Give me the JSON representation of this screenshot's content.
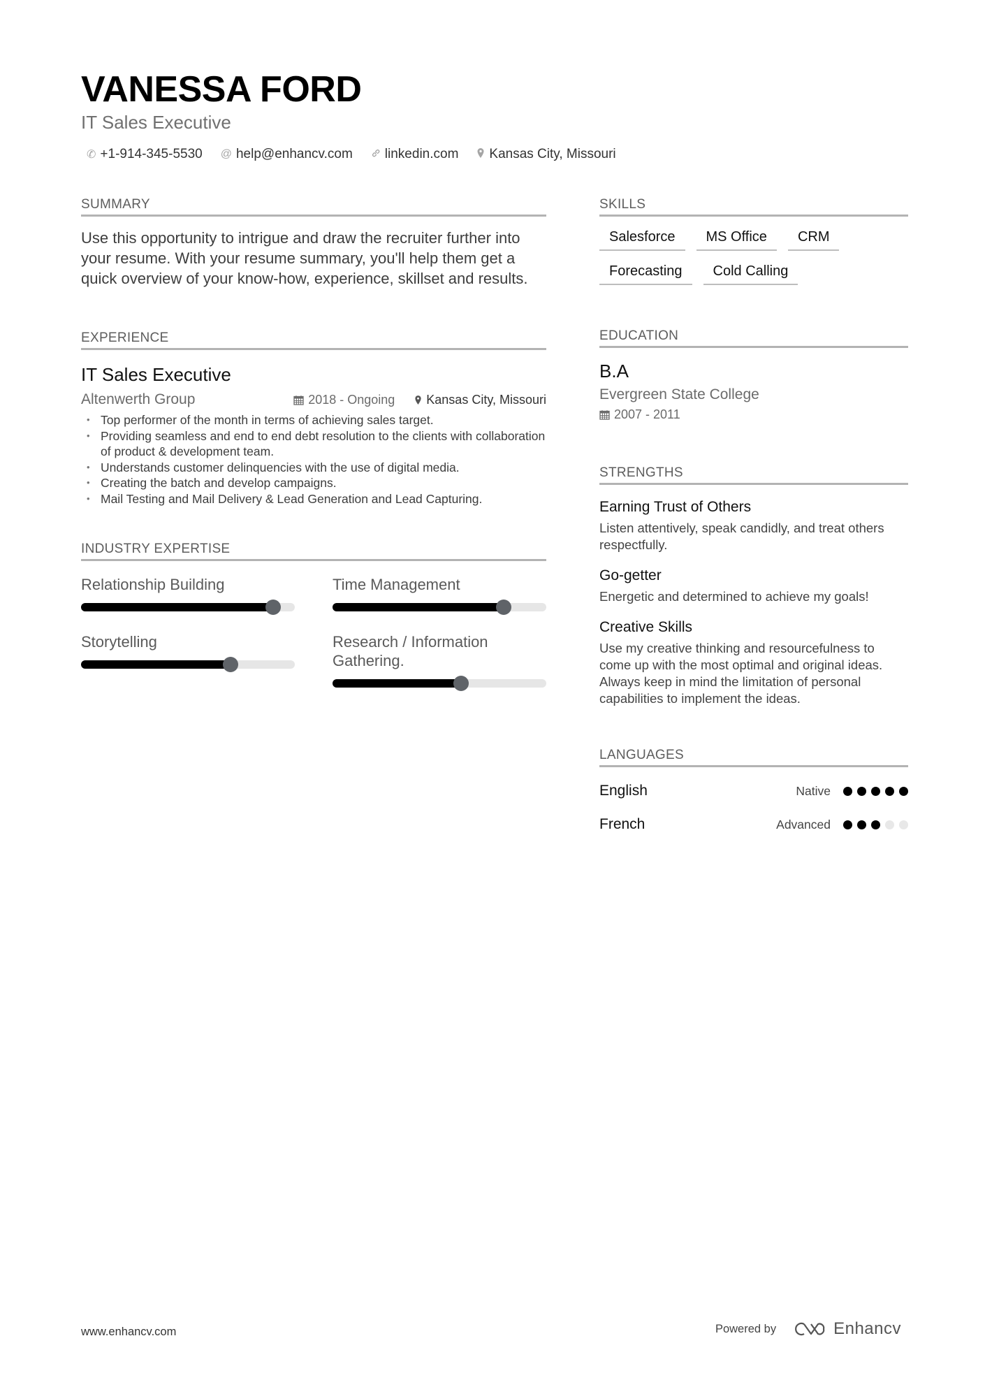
{
  "header": {
    "name": "VANESSA FORD",
    "title": "IT Sales Executive",
    "contacts": [
      {
        "icon": "phone-icon",
        "glyph": "✆",
        "text": "+1-914-345-5530"
      },
      {
        "icon": "at-icon",
        "glyph": "@",
        "text": "help@enhancv.com"
      },
      {
        "icon": "link-icon",
        "glyph": "🔗︎",
        "text": "linkedin.com"
      },
      {
        "icon": "location-pin-icon",
        "glyph": "⚲",
        "text": "Kansas City, Missouri"
      }
    ]
  },
  "summary": {
    "heading": "SUMMARY",
    "text": "Use this opportunity to intrigue and draw the recruiter further into your resume. With your resume summary, you'll help them get a quick overview of your know-how, experience, skillset and results."
  },
  "experience": {
    "heading": "EXPERIENCE",
    "items": [
      {
        "role": "IT Sales Executive",
        "company": "Altenwerth Group",
        "dates": "2018 - Ongoing",
        "location": "Kansas City, Missouri",
        "bullets": [
          "Top performer of the month in terms of achieving sales target.",
          "Providing seamless and end to end debt resolution to the clients with collaboration of product & development team.",
          "Understands customer delinquencies with the use of digital media.",
          "Creating the batch and develop campaigns.",
          "Mail Testing and Mail Delivery & Lead Generation and Lead Capturing."
        ]
      }
    ]
  },
  "industry_expertise": {
    "heading": "INDUSTRY EXPERTISE",
    "items": [
      {
        "label": "Relationship Building",
        "level": 0.9
      },
      {
        "label": "Time Management",
        "level": 0.8
      },
      {
        "label": "Storytelling",
        "level": 0.7
      },
      {
        "label": "Research / Information Gathering.",
        "level": 0.6
      }
    ]
  },
  "skills": {
    "heading": "SKILLS",
    "items": [
      "Salesforce",
      "MS Office",
      "CRM",
      "Forecasting",
      "Cold Calling"
    ]
  },
  "education": {
    "heading": "EDUCATION",
    "items": [
      {
        "degree": "B.A",
        "school": "Evergreen State College",
        "dates": "2007 - 2011"
      }
    ]
  },
  "strengths": {
    "heading": "STRENGTHS",
    "items": [
      {
        "title": "Earning Trust of Others",
        "description": "Listen attentively, speak candidly, and treat others respectfully."
      },
      {
        "title": "Go-getter",
        "description": "Energetic and determined to achieve my goals!"
      },
      {
        "title": "Creative Skills",
        "description": "Use my creative thinking and resourcefulness to come up with the most optimal and original ideas. Always keep in mind the limitation of personal capabilities to implement the ideas."
      }
    ]
  },
  "languages": {
    "heading": "LANGUAGES",
    "items": [
      {
        "name": "English",
        "level": "Native",
        "dots": 5,
        "max_dots": 5
      },
      {
        "name": "French",
        "level": "Advanced",
        "dots": 3,
        "max_dots": 5
      }
    ]
  },
  "footer": {
    "website": "www.enhancv.com",
    "powered_by": "Powered by",
    "brand": "Enhancv"
  },
  "icons": {
    "calendar": "▦",
    "location": "⚲"
  }
}
